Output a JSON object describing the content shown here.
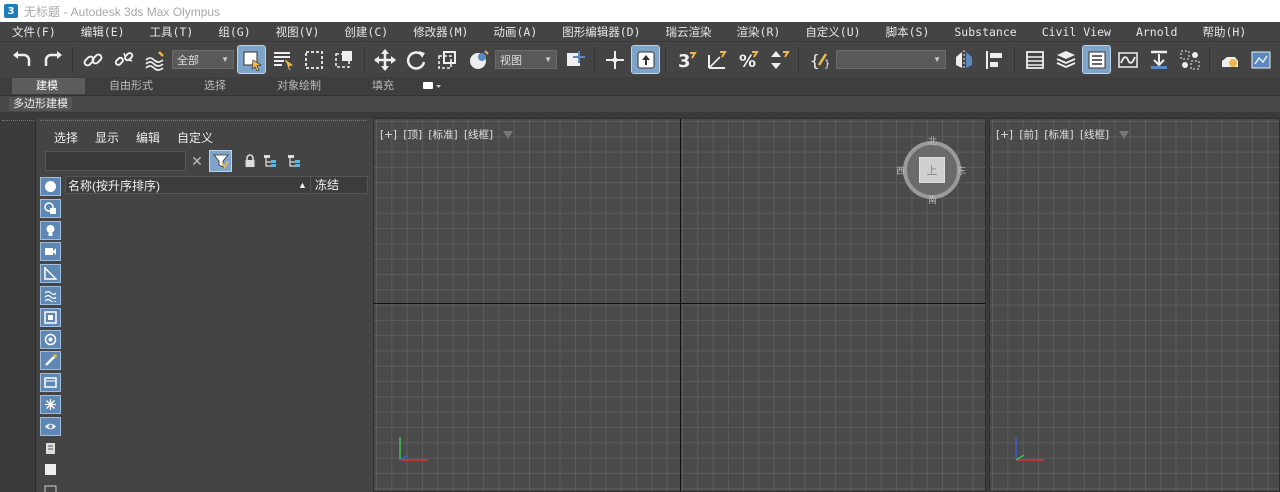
{
  "titlebar": {
    "icon": "3",
    "title": "无标题 - Autodesk 3ds Max Olympus"
  },
  "menu": [
    "文件(F)",
    "编辑(E)",
    "工具(T)",
    "组(G)",
    "视图(V)",
    "创建(C)",
    "修改器(M)",
    "动画(A)",
    "图形编辑器(D)",
    "瑞云渲染",
    "渲染(R)",
    "自定义(U)",
    "脚本(S)",
    "Substance",
    "Civil View",
    "Arnold",
    "帮助(H)"
  ],
  "toolbar": {
    "selection_filter": "全部",
    "ref_coord": "视图",
    "named_selection": ""
  },
  "ribbon": {
    "tabs": [
      "建模",
      "自由形式",
      "选择",
      "对象绘制",
      "填充"
    ],
    "active_tab": "建模",
    "panel_label": "多边形建模"
  },
  "explorer": {
    "menu": [
      "选择",
      "显示",
      "编辑",
      "自定义"
    ],
    "search_value": "",
    "columns": {
      "name": "名称(按升序排序)",
      "sort_indicator": "▲",
      "freeze": "冻结"
    }
  },
  "viewports": {
    "top": {
      "plus": "[+]",
      "view": "[顶]",
      "shading": "[标准]",
      "style": "[线框]"
    },
    "front": {
      "plus": "[+]",
      "view": "[前]",
      "shading": "[标准]",
      "style": "[线框]"
    },
    "viewcube": {
      "north": "北",
      "south": "南",
      "east": "东",
      "west": "西",
      "face": "上"
    }
  },
  "colors": {
    "accent_blue": "#7fa4c9",
    "bg_dark": "#444444",
    "grid": "#5c5c5c"
  }
}
